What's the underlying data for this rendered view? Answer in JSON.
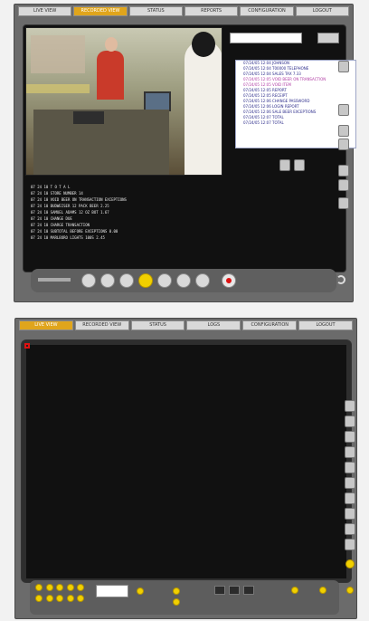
{
  "top": {
    "tabs": [
      "LIVE VIEW",
      "RECORDED VIEW",
      "STATUS",
      "REPORTS",
      "CONFIGURATION",
      "LOGOUT"
    ],
    "active_tab": 1
  },
  "bottom": {
    "tabs": [
      "LIVE VIEW",
      "RECORDED VIEW",
      "STATUS",
      "LOGS",
      "CONFIGURATION",
      "LOGOUT"
    ],
    "active_tab": 0
  },
  "transaction_panel": {
    "lines": [
      {
        "text": "07/24/05 12:04 JOHNSON",
        "pink": false
      },
      {
        "text": "07/24/05 12:04 T00000  TELEPHONE",
        "pink": false
      },
      {
        "text": "07/24/05 12:04 SALES TAX  7.33",
        "pink": false
      },
      {
        "text": "07/24/05 12:05 VOID BEER ON TRANSACTION",
        "pink": true
      },
      {
        "text": "07/24/05 12:05 VOID ITEM",
        "pink": true
      },
      {
        "text": "07/24/05 12:05 REPORT",
        "pink": false
      },
      {
        "text": "07/24/05 12:05 RECEIPT",
        "pink": false
      },
      {
        "text": "07/24/05 12:06 CHANGE PASSWORD",
        "pink": false
      },
      {
        "text": "07/24/05 12:06 LOGIN REPORT",
        "pink": false
      },
      {
        "text": "07/24/05 12:06 SALE BEER EXCEPTIONS",
        "pink": false
      },
      {
        "text": "07/24/05 12:07 TOTAL",
        "pink": false
      },
      {
        "text": "07/24/05 12:07 TOTAL",
        "pink": false
      }
    ]
  },
  "terminal": {
    "lines": [
      "07 24 10          T O T A L",
      "07 24 10       STORE NUMBER 14",
      "07 24 10     VOID BEER ON TRANSACTION EXCEPTIONS",
      "07 24 10  BUDWEISER 12 PACK BEER            2.25",
      "07 24 10  SAMUEL ADAMS 12 OZ BOT            1.67",
      "07 24 10  CHANGE DUE",
      "07 24 10  CHARGE TRANSACTION",
      "07 24 10  SUBTOTAL BEFORE EXCEPTIONS        0.00",
      "07 24 10  MARLBORO LIGHTS 100S              2.45"
    ]
  }
}
